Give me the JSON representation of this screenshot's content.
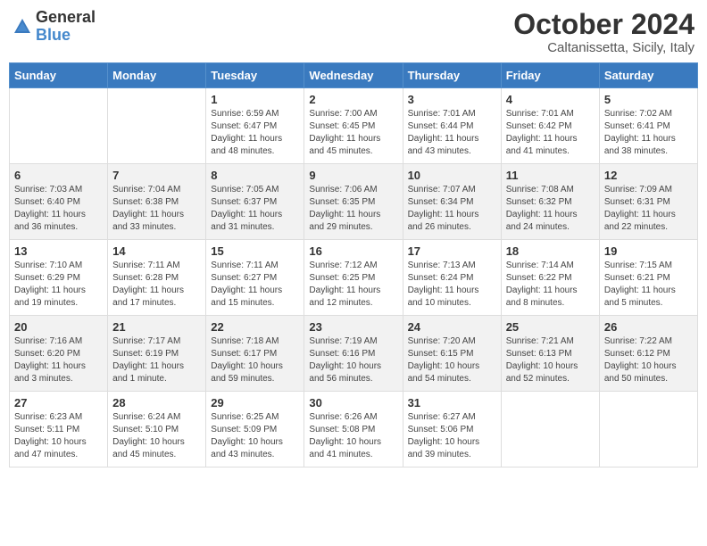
{
  "header": {
    "logo_general": "General",
    "logo_blue": "Blue",
    "month_year": "October 2024",
    "location": "Caltanissetta, Sicily, Italy"
  },
  "weekdays": [
    "Sunday",
    "Monday",
    "Tuesday",
    "Wednesday",
    "Thursday",
    "Friday",
    "Saturday"
  ],
  "weeks": [
    [
      {
        "day": "",
        "info": ""
      },
      {
        "day": "",
        "info": ""
      },
      {
        "day": "1",
        "info": "Sunrise: 6:59 AM\nSunset: 6:47 PM\nDaylight: 11 hours and 48 minutes."
      },
      {
        "day": "2",
        "info": "Sunrise: 7:00 AM\nSunset: 6:45 PM\nDaylight: 11 hours and 45 minutes."
      },
      {
        "day": "3",
        "info": "Sunrise: 7:01 AM\nSunset: 6:44 PM\nDaylight: 11 hours and 43 minutes."
      },
      {
        "day": "4",
        "info": "Sunrise: 7:01 AM\nSunset: 6:42 PM\nDaylight: 11 hours and 41 minutes."
      },
      {
        "day": "5",
        "info": "Sunrise: 7:02 AM\nSunset: 6:41 PM\nDaylight: 11 hours and 38 minutes."
      }
    ],
    [
      {
        "day": "6",
        "info": "Sunrise: 7:03 AM\nSunset: 6:40 PM\nDaylight: 11 hours and 36 minutes."
      },
      {
        "day": "7",
        "info": "Sunrise: 7:04 AM\nSunset: 6:38 PM\nDaylight: 11 hours and 33 minutes."
      },
      {
        "day": "8",
        "info": "Sunrise: 7:05 AM\nSunset: 6:37 PM\nDaylight: 11 hours and 31 minutes."
      },
      {
        "day": "9",
        "info": "Sunrise: 7:06 AM\nSunset: 6:35 PM\nDaylight: 11 hours and 29 minutes."
      },
      {
        "day": "10",
        "info": "Sunrise: 7:07 AM\nSunset: 6:34 PM\nDaylight: 11 hours and 26 minutes."
      },
      {
        "day": "11",
        "info": "Sunrise: 7:08 AM\nSunset: 6:32 PM\nDaylight: 11 hours and 24 minutes."
      },
      {
        "day": "12",
        "info": "Sunrise: 7:09 AM\nSunset: 6:31 PM\nDaylight: 11 hours and 22 minutes."
      }
    ],
    [
      {
        "day": "13",
        "info": "Sunrise: 7:10 AM\nSunset: 6:29 PM\nDaylight: 11 hours and 19 minutes."
      },
      {
        "day": "14",
        "info": "Sunrise: 7:11 AM\nSunset: 6:28 PM\nDaylight: 11 hours and 17 minutes."
      },
      {
        "day": "15",
        "info": "Sunrise: 7:11 AM\nSunset: 6:27 PM\nDaylight: 11 hours and 15 minutes."
      },
      {
        "day": "16",
        "info": "Sunrise: 7:12 AM\nSunset: 6:25 PM\nDaylight: 11 hours and 12 minutes."
      },
      {
        "day": "17",
        "info": "Sunrise: 7:13 AM\nSunset: 6:24 PM\nDaylight: 11 hours and 10 minutes."
      },
      {
        "day": "18",
        "info": "Sunrise: 7:14 AM\nSunset: 6:22 PM\nDaylight: 11 hours and 8 minutes."
      },
      {
        "day": "19",
        "info": "Sunrise: 7:15 AM\nSunset: 6:21 PM\nDaylight: 11 hours and 5 minutes."
      }
    ],
    [
      {
        "day": "20",
        "info": "Sunrise: 7:16 AM\nSunset: 6:20 PM\nDaylight: 11 hours and 3 minutes."
      },
      {
        "day": "21",
        "info": "Sunrise: 7:17 AM\nSunset: 6:19 PM\nDaylight: 11 hours and 1 minute."
      },
      {
        "day": "22",
        "info": "Sunrise: 7:18 AM\nSunset: 6:17 PM\nDaylight: 10 hours and 59 minutes."
      },
      {
        "day": "23",
        "info": "Sunrise: 7:19 AM\nSunset: 6:16 PM\nDaylight: 10 hours and 56 minutes."
      },
      {
        "day": "24",
        "info": "Sunrise: 7:20 AM\nSunset: 6:15 PM\nDaylight: 10 hours and 54 minutes."
      },
      {
        "day": "25",
        "info": "Sunrise: 7:21 AM\nSunset: 6:13 PM\nDaylight: 10 hours and 52 minutes."
      },
      {
        "day": "26",
        "info": "Sunrise: 7:22 AM\nSunset: 6:12 PM\nDaylight: 10 hours and 50 minutes."
      }
    ],
    [
      {
        "day": "27",
        "info": "Sunrise: 6:23 AM\nSunset: 5:11 PM\nDaylight: 10 hours and 47 minutes."
      },
      {
        "day": "28",
        "info": "Sunrise: 6:24 AM\nSunset: 5:10 PM\nDaylight: 10 hours and 45 minutes."
      },
      {
        "day": "29",
        "info": "Sunrise: 6:25 AM\nSunset: 5:09 PM\nDaylight: 10 hours and 43 minutes."
      },
      {
        "day": "30",
        "info": "Sunrise: 6:26 AM\nSunset: 5:08 PM\nDaylight: 10 hours and 41 minutes."
      },
      {
        "day": "31",
        "info": "Sunrise: 6:27 AM\nSunset: 5:06 PM\nDaylight: 10 hours and 39 minutes."
      },
      {
        "day": "",
        "info": ""
      },
      {
        "day": "",
        "info": ""
      }
    ]
  ]
}
